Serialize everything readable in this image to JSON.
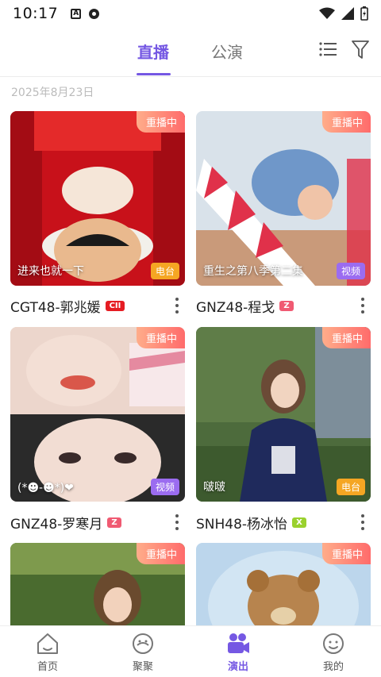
{
  "status": {
    "time": "10:17",
    "icon_a": "A"
  },
  "tabs": [
    {
      "label": "直播",
      "active": true
    },
    {
      "label": "公演",
      "active": false
    }
  ],
  "toolbar": {
    "list_icon": "list-icon",
    "filter_icon": "filter-icon"
  },
  "date_label": "2025年8月23日",
  "cards": [
    {
      "badge": "重播中",
      "caption": "进来也就一下",
      "type": "电台",
      "name": "CGT48-郭兆媛",
      "team": "CII"
    },
    {
      "badge": "重播中",
      "caption": "重生之第八季第二集",
      "type": "视频",
      "name": "GNZ48-程戈",
      "team": "Z"
    },
    {
      "badge": "重播中",
      "caption": "(*☻-☻*)❤",
      "type": "视频",
      "name": "GNZ48-罗寒月",
      "team": "Z"
    },
    {
      "badge": "重播中",
      "caption": "啵啵",
      "type": "电台",
      "name": "SNH48-杨冰怡",
      "team": "X"
    },
    {
      "badge": "重播中"
    },
    {
      "badge": "重播中"
    }
  ],
  "bottom_nav": [
    {
      "label": "首页",
      "icon": "home-icon",
      "active": false
    },
    {
      "label": "聚聚",
      "icon": "chat-face-icon",
      "active": false
    },
    {
      "label": "演出",
      "icon": "video-camera-icon",
      "active": true
    },
    {
      "label": "我的",
      "icon": "profile-face-icon",
      "active": false
    }
  ],
  "colors": {
    "accent": "#7558e3",
    "badge_gradient": [
      "#ffad8a",
      "#ff6b6b"
    ],
    "radio_tag": "#f5a623",
    "video_tag": "#9b6cf0"
  }
}
